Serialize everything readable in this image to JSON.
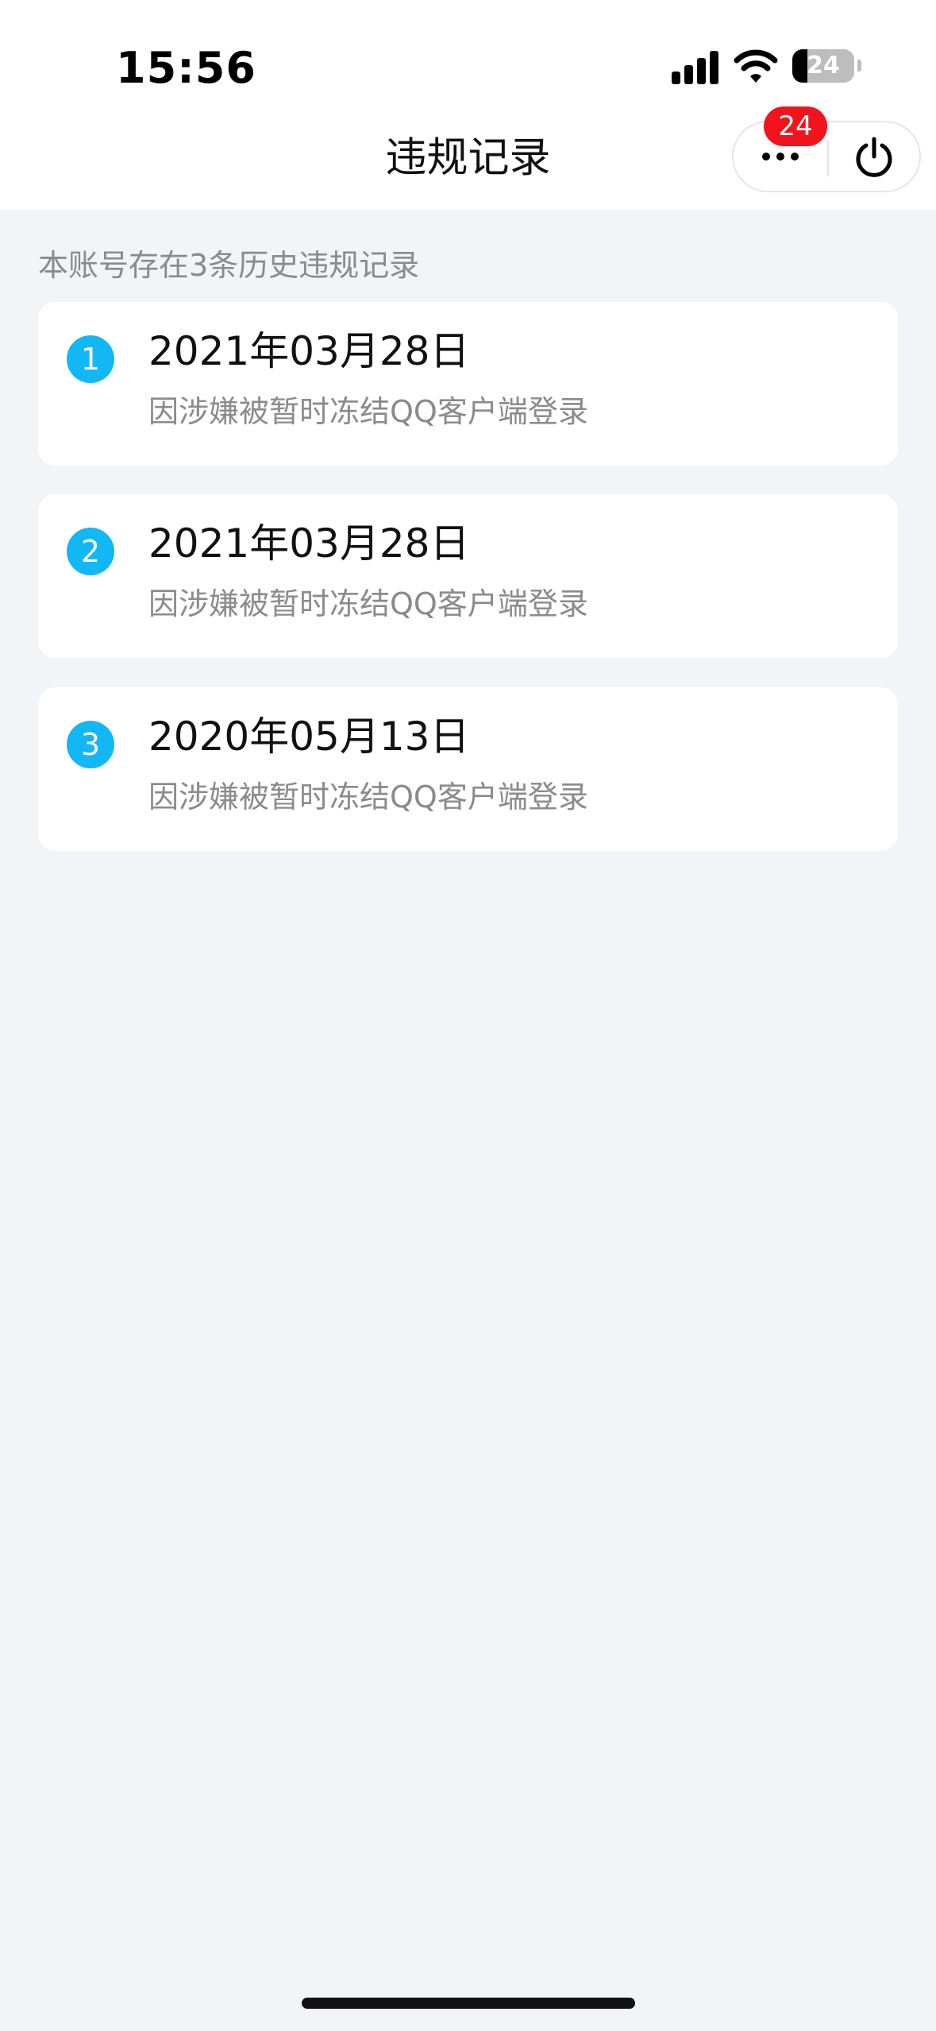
{
  "status_bar": {
    "time": "15:56",
    "battery": "24"
  },
  "nav": {
    "title": "违规记录",
    "badge_count": "24"
  },
  "summary": "本账号存在3条历史违规记录",
  "records": [
    {
      "index": "1",
      "date": "2021年03月28日",
      "reason": "因涉嫌被暂时冻结QQ客户端登录"
    },
    {
      "index": "2",
      "date": "2021年03月28日",
      "reason": "因涉嫌被暂时冻结QQ客户端登录"
    },
    {
      "index": "3",
      "date": "2020年05月13日",
      "reason": "因涉嫌被暂时冻结QQ客户端登录"
    }
  ],
  "colors": {
    "accent": "#12b7f5",
    "badge": "#f2141d",
    "background": "#f3f4f8"
  },
  "icons": [
    "signal-icon",
    "wifi-icon",
    "battery-icon",
    "more-icon",
    "power-icon"
  ]
}
